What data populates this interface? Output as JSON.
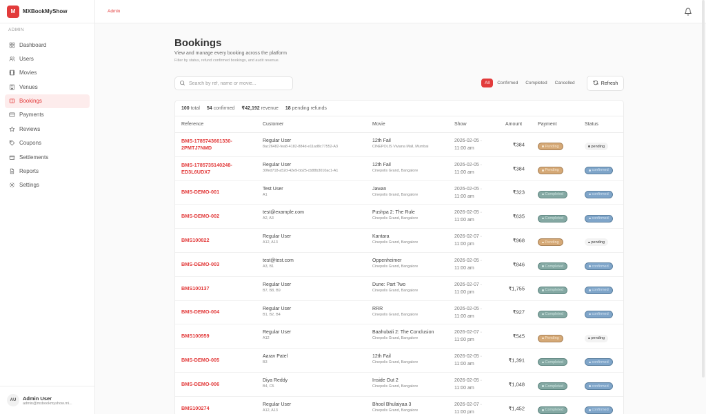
{
  "brand": {
    "logo_text": "M",
    "name": "MXBookMyShow"
  },
  "sidebar": {
    "section_label": "ADMIN",
    "items": [
      {
        "label": "Dashboard",
        "icon": "grid-icon"
      },
      {
        "label": "Users",
        "icon": "users-icon"
      },
      {
        "label": "Movies",
        "icon": "film-icon"
      },
      {
        "label": "Venues",
        "icon": "building-icon"
      },
      {
        "label": "Bookings",
        "icon": "ticket-icon",
        "active": true
      },
      {
        "label": "Payments",
        "icon": "card-icon"
      },
      {
        "label": "Reviews",
        "icon": "star-icon"
      },
      {
        "label": "Coupons",
        "icon": "tag-icon"
      },
      {
        "label": "Settlements",
        "icon": "wallet-icon"
      },
      {
        "label": "Reports",
        "icon": "document-icon"
      },
      {
        "label": "Settings",
        "icon": "gear-icon"
      }
    ],
    "user": {
      "initials": "AU",
      "name": "Admin User",
      "email": "admin@mxbookmyshow.mi..."
    }
  },
  "topbar": {
    "breadcrumb": "Admin"
  },
  "page": {
    "title": "Bookings",
    "subtitle": "View and manage every booking across the platform",
    "subtitle2": "Filter by status, refund confirmed bookings, and audit revenue."
  },
  "search": {
    "placeholder": "Search by ref, name or movie...",
    "value": ""
  },
  "filters": [
    {
      "label": "All",
      "active": true
    },
    {
      "label": "Confirmed"
    },
    {
      "label": "Completed"
    },
    {
      "label": "Cancelled"
    }
  ],
  "refresh_label": "Refresh",
  "summary": {
    "total_value": "100",
    "total_label": "total",
    "confirmed_value": "54",
    "confirmed_label": "confirmed",
    "revenue_value": "₹42,192",
    "revenue_label": "revenue",
    "refunds_value": "18",
    "refunds_label": "pending refunds"
  },
  "table": {
    "headers": [
      "Reference",
      "Customer",
      "Movie",
      "Show",
      "Amount",
      "Payment",
      "Status"
    ],
    "rows": [
      {
        "ref": "BMS-1785743661330-2PMTJ7NMD",
        "customer": "Regular User",
        "customer_sub": "8ac26482-fea8-4182-884d-e11ad8c77552-A3",
        "movie": "12th Fail",
        "venue": "CINEPOLIS Viviana Mall, Mumbai",
        "show_date": "2026-02-05 ·",
        "show_time": "11:00 am",
        "amount": "₹384",
        "payment": "Pending",
        "payment_kind": "pay-pending",
        "status": "pending",
        "status_kind": "st-pending"
      },
      {
        "ref": "BMS-1785735140248-ED3L6UDX7",
        "customer": "Regular User",
        "customer_sub": "30fed718-a52d-42e9-bb25-cb88b3010ac1-A1",
        "movie": "12th Fail",
        "venue": "Cinepolis Grand, Bangalore",
        "show_date": "2026-02-05 ·",
        "show_time": "11:00 am",
        "amount": "₹384",
        "payment": "Pending",
        "payment_kind": "pay-pending",
        "status": "confirmed",
        "status_kind": "st-confirmed"
      },
      {
        "ref": "BMS-DEMO-001",
        "customer": "Test User",
        "customer_sub": "A1",
        "movie": "Jawan",
        "venue": "Cinepolis Grand, Bangalore",
        "show_date": "2026-02-05 ·",
        "show_time": "11:00 am",
        "amount": "₹323",
        "payment": "Completed",
        "payment_kind": "pay-completed",
        "status": "confirmed",
        "status_kind": "st-confirmed"
      },
      {
        "ref": "BMS-DEMO-002",
        "customer": "test@example.com",
        "customer_sub": "A2, A3",
        "movie": "Pushpa 2: The Rule",
        "venue": "Cinepolis Grand, Bangalore",
        "show_date": "2026-02-05 ·",
        "show_time": "11:00 am",
        "amount": "₹635",
        "payment": "Completed",
        "payment_kind": "pay-completed",
        "status": "confirmed",
        "status_kind": "st-confirmed"
      },
      {
        "ref": "BMS100822",
        "customer": "Regular User",
        "customer_sub": "A12, A13",
        "movie": "Kantara",
        "venue": "Cinepolis Grand, Bangalore",
        "show_date": "2026-02-07 ·",
        "show_time": "11:00 pm",
        "amount": "₹968",
        "payment": "Pending",
        "payment_kind": "pay-pending",
        "status": "pending",
        "status_kind": "st-pending"
      },
      {
        "ref": "BMS-DEMO-003",
        "customer": "test@test.com",
        "customer_sub": "A3, B1",
        "movie": "Oppenheimer",
        "venue": "Cinepolis Grand, Bangalore",
        "show_date": "2026-02-05 ·",
        "show_time": "11:00 am",
        "amount": "₹846",
        "payment": "Completed",
        "payment_kind": "pay-completed",
        "status": "confirmed",
        "status_kind": "st-confirmed"
      },
      {
        "ref": "BMS100137",
        "customer": "Regular User",
        "customer_sub": "B7, B8, B9",
        "movie": "Dune: Part Two",
        "venue": "Cinepolis Grand, Bangalore",
        "show_date": "2026-02-07 ·",
        "show_time": "11:00 pm",
        "amount": "₹1,755",
        "payment": "Completed",
        "payment_kind": "pay-completed",
        "status": "confirmed",
        "status_kind": "st-confirmed"
      },
      {
        "ref": "BMS-DEMO-004",
        "customer": "Regular User",
        "customer_sub": "B1, B2, B4",
        "movie": "RRR",
        "venue": "Cinepolis Grand, Bangalore",
        "show_date": "2026-02-05 ·",
        "show_time": "11:00 am",
        "amount": "₹927",
        "payment": "Completed",
        "payment_kind": "pay-completed",
        "status": "confirmed",
        "status_kind": "st-confirmed"
      },
      {
        "ref": "BMS100959",
        "customer": "Regular User",
        "customer_sub": "A12",
        "movie": "Baahubali 2: The Conclusion",
        "venue": "Cinepolis Grand, Bangalore",
        "show_date": "2026-02-07 ·",
        "show_time": "11:00 pm",
        "amount": "₹545",
        "payment": "Pending",
        "payment_kind": "pay-pending",
        "status": "pending",
        "status_kind": "st-pending"
      },
      {
        "ref": "BMS-DEMO-005",
        "customer": "Aarav Patel",
        "customer_sub": "B3",
        "movie": "12th Fail",
        "venue": "Cinepolis Grand, Bangalore",
        "show_date": "2026-02-05 ·",
        "show_time": "11:00 am",
        "amount": "₹1,391",
        "payment": "Completed",
        "payment_kind": "pay-completed",
        "status": "confirmed",
        "status_kind": "st-confirmed"
      },
      {
        "ref": "BMS-DEMO-006",
        "customer": "Diya Reddy",
        "customer_sub": "B4, C5",
        "movie": "Inside Out 2",
        "venue": "Cinepolis Grand, Bangalore",
        "show_date": "2026-02-05 ·",
        "show_time": "11:00 am",
        "amount": "₹1,048",
        "payment": "Completed",
        "payment_kind": "pay-completed",
        "status": "confirmed",
        "status_kind": "st-confirmed"
      },
      {
        "ref": "BMS100274",
        "customer": "Regular User",
        "customer_sub": "A12, A13",
        "movie": "Bhool Bhulaiyaa 3",
        "venue": "Cinepolis Grand, Bangalore",
        "show_date": "2026-02-07 ·",
        "show_time": "11:00 pm",
        "amount": "₹1,452",
        "payment": "Completed",
        "payment_kind": "pay-completed",
        "status": "confirmed",
        "status_kind": "st-confirmed"
      }
    ]
  }
}
